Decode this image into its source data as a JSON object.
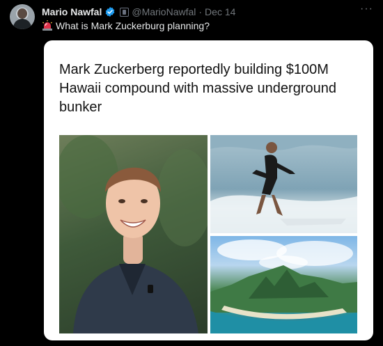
{
  "tweet": {
    "author_name": "Mario Nawfal",
    "handle": "@MarioNawfal",
    "separator": "·",
    "date": "Dec 14",
    "more": "···",
    "text": "What is Mark Zuckerburg planning?",
    "icons": {
      "verified": "verified-badge-icon",
      "affiliation": "affiliation-badge-icon",
      "alert": "rotating-light-emoji-icon"
    },
    "colors": {
      "verified": "#1d9bf0",
      "alert": "#e0334a"
    }
  },
  "card": {
    "headline": "Mark Zuckerberg reportedly building $100M Hawaii compound with massive underground bunker",
    "images": [
      "portrait-photo",
      "surfing-photo",
      "island-aerial-photo"
    ]
  }
}
